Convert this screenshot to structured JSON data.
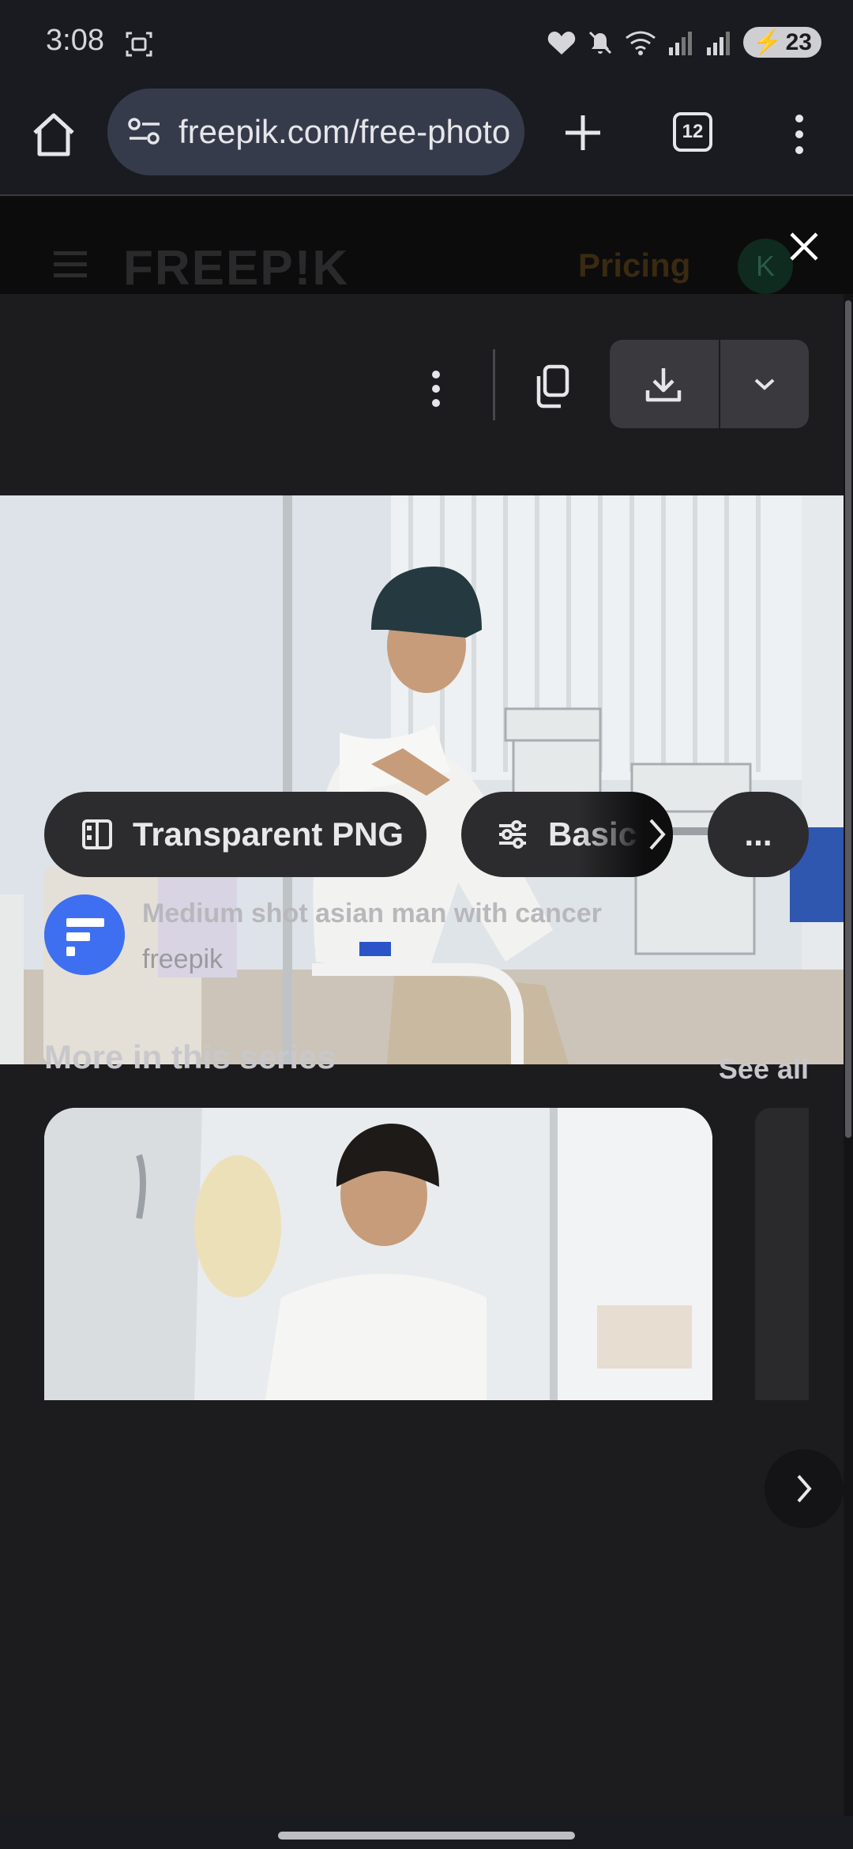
{
  "status_bar": {
    "time": "3:08",
    "battery": "23"
  },
  "browser": {
    "url": "freepik.com/free-photo",
    "tab_count": "12"
  },
  "site_header": {
    "logo": "FREEP!K",
    "pricing": "Pricing",
    "avatar_letter": "K"
  },
  "modal": {
    "chips": {
      "transparent_png": "Transparent PNG",
      "basic": "Basic",
      "more": "..."
    },
    "author": {
      "photo_title": "Medium shot asian man with cancer",
      "name": "freepik"
    },
    "series": {
      "title": "More in this series",
      "see_all": "See all"
    }
  },
  "colors": {
    "accent_blue": "#3e6ff0",
    "modal_bg": "#1c1c1e",
    "chip_bg": "#2c2c2e"
  }
}
